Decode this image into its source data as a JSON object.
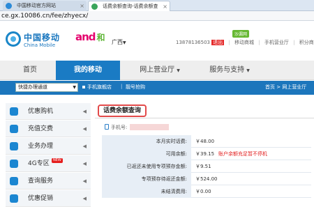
{
  "browser": {
    "tabs": [
      {
        "title": "中国移动官方网站",
        "close": "×"
      },
      {
        "title": "话费余额查询-话费余额查",
        "close": "×"
      }
    ],
    "address": "ce.gx.10086.cn/fee/zhyecx/"
  },
  "header": {
    "logo_cn": "中国移动",
    "logo_en": "China Mobile",
    "and_logo": "and",
    "and_he": "和",
    "region": "广西",
    "promo_badge": "沙漏网",
    "user_phone": "13878136503",
    "logout": "退出",
    "links": [
      "移动商城",
      "手机营业厅",
      "积分商城"
    ]
  },
  "nav": {
    "items": [
      "首页",
      "我的移动",
      "网上营业厅",
      "服务与支持"
    ],
    "active_index": 1
  },
  "subbar": {
    "quick_select": "快捷办理通道",
    "links": [
      "手机旗舰店",
      "靓号抢购"
    ],
    "breadcrumb": "首页 > 网上营业厅"
  },
  "sidebar": {
    "items": [
      {
        "label": "优惠购机",
        "icon": "phone-cart-icon"
      },
      {
        "label": "充值交费",
        "icon": "recharge-icon"
      },
      {
        "label": "业务办理",
        "icon": "business-icon"
      },
      {
        "label": "4G专区",
        "icon": "4g-icon",
        "badge": "NEW"
      },
      {
        "label": "查询服务",
        "icon": "search-service-icon"
      },
      {
        "label": "优惠促销",
        "icon": "promotion-icon"
      }
    ]
  },
  "main": {
    "section_title": "话费余额查询",
    "phone_label": "手机号:",
    "rows": [
      {
        "label": "本月实时话费:",
        "value": "￥48.00",
        "note": ""
      },
      {
        "label": "可用余额:",
        "value": "￥39.15",
        "note": "账户余额充足暂不停机"
      },
      {
        "label": "已返还未使用专项预存金额:",
        "value": "￥9.51",
        "note": ""
      },
      {
        "label": "专项预存待返还金额:",
        "value": "￥524.00",
        "note": ""
      },
      {
        "label": "未结清费用:",
        "value": "￥0.00",
        "note": ""
      }
    ]
  },
  "colors": {
    "brand_blue": "#1a7bc4",
    "alert_red": "#e21b1b"
  }
}
